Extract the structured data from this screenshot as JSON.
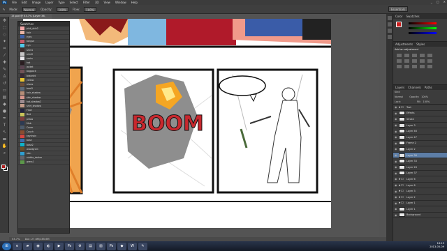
{
  "app": {
    "logo": "Ps"
  },
  "menu": [
    "File",
    "Edit",
    "Image",
    "Layer",
    "Type",
    "Select",
    "Filter",
    "3D",
    "View",
    "Window",
    "Help"
  ],
  "options": {
    "mode_label": "Mode:",
    "mode_value": "Normal",
    "opacity_label": "Opacity:",
    "opacity_value": "100%",
    "flow_label": "Flow:",
    "flow_value": "100%",
    "workspace": "Essentials"
  },
  "document": {
    "tab_title": "15.psd @ 53.7% (Layer 36, RGB/8#) *"
  },
  "swatches_panel": {
    "title": "Swatches",
    "items": [
      {
        "name": "pink_skin2",
        "color": "#f4a6a8"
      },
      {
        "name": "hair",
        "color": "#e8b3a4"
      },
      {
        "name": "eyes",
        "color": "#3c5fa7"
      },
      {
        "name": "tongue",
        "color": "#c45a6a"
      },
      {
        "name": "cyn",
        "color": "#50c8e8"
      },
      {
        "name": "shirt1",
        "color": "#3d2c2c"
      },
      {
        "name": "shirt2",
        "color": "#c7c5c6"
      },
      {
        "name": "socks",
        "color": "#e9e6ea"
      },
      {
        "name": "hat",
        "color": "#2a1d20"
      },
      {
        "name": "jacket",
        "color": "#5b4450"
      },
      {
        "name": "bagpack",
        "color": "#725357"
      },
      {
        "name": "bracelet",
        "color": "#3a2933"
      },
      {
        "name": "yellow",
        "color": "#e8c430"
      },
      {
        "name": "shoes",
        "color": "#6d4e38"
      },
      {
        "name": "boot2",
        "color": "#5d6a78"
      },
      {
        "name": "hair_shadow",
        "color": "#b58d77"
      },
      {
        "name": "skin_shadow",
        "color": "#d7968c"
      },
      {
        "name": "hat_shadow2",
        "color": "#9c8a8e"
      },
      {
        "name": "shirt_shadow",
        "color": "#c39a87"
      },
      {
        "name": "Floor",
        "color": "#23233e"
      },
      {
        "name": "Bed",
        "color": "#c9c35a"
      },
      {
        "name": "pillow",
        "color": "#7f3d3d"
      },
      {
        "name": "Mob",
        "color": "#2d3a53"
      },
      {
        "name": "Cover",
        "color": "#4e5b6a"
      },
      {
        "name": "Couch",
        "color": "#8a4d31"
      },
      {
        "name": "keychain",
        "color": "#d64540"
      },
      {
        "name": "base",
        "color": "#3c6db0"
      },
      {
        "name": "base2",
        "color": "#0fb3c9"
      },
      {
        "name": "woodgrain",
        "color": "#6b5028"
      },
      {
        "name": "skin",
        "color": "#2f9fd2"
      },
      {
        "name": "rubble_darker",
        "color": "#63646c"
      },
      {
        "name": "grass1",
        "color": "#5c984a"
      }
    ]
  },
  "layers_panel": {
    "tabs": [
      "Layers",
      "Channels",
      "Paths"
    ],
    "kind_label": "Kind",
    "blend_mode": "Normal",
    "opacity_label": "Opacity:",
    "opacity_value": "100%",
    "lock_label": "Lock:",
    "fill_label": "Fill:",
    "fill_value": "100%",
    "layers": [
      {
        "name": "Text",
        "type": "folder",
        "selected": false
      },
      {
        "name": "Effects",
        "type": "layer",
        "selected": false
      },
      {
        "name": "Stroke",
        "type": "layer",
        "selected": false
      },
      {
        "name": "Layer 3",
        "type": "layer",
        "selected": false
      },
      {
        "name": "Layer 46",
        "type": "layer",
        "selected": false
      },
      {
        "name": "Layer 47",
        "type": "layer",
        "selected": false
      },
      {
        "name": "Frame 2",
        "type": "layer",
        "selected": false
      },
      {
        "name": "Layer 2",
        "type": "layer",
        "selected": false
      },
      {
        "name": "Layer 36",
        "type": "layer",
        "selected": true
      },
      {
        "name": "Layer 33",
        "type": "layer",
        "selected": false
      },
      {
        "name": "Layer 26",
        "type": "layer",
        "selected": false
      },
      {
        "name": "Layer 37",
        "type": "layer",
        "selected": false
      },
      {
        "name": "Layer 6",
        "type": "folder",
        "selected": false
      },
      {
        "name": "Layer 8",
        "type": "folder",
        "selected": false
      },
      {
        "name": "Layer 3",
        "type": "folder",
        "selected": false
      },
      {
        "name": "Layer 2",
        "type": "folder",
        "selected": false
      },
      {
        "name": "Layer 1",
        "type": "folder",
        "selected": false
      },
      {
        "name": "Layer 1",
        "type": "layer",
        "selected": false
      },
      {
        "name": "Background",
        "type": "layer",
        "selected": false
      }
    ]
  },
  "adjustments_panel": {
    "tabs": [
      "Adjustments",
      "Styles"
    ],
    "heading": "Add an adjustment"
  },
  "color_panel": {
    "tabs": [
      "Color",
      "Swatches"
    ],
    "fg_color": "#cc2020"
  },
  "comic": {
    "sound_effect": "BOOM"
  },
  "status": {
    "zoom": "53.7%",
    "doc": "Doc: 27.6M/185.6M"
  },
  "taskbar": {
    "apps": [
      "start",
      "ie",
      "explorer",
      "chrome",
      "firefox",
      "media",
      "photoshop",
      "steam",
      "folder",
      "files",
      "ps2",
      "app",
      "word",
      "paint"
    ],
    "time": "16:15",
    "date": "2013-05-09"
  }
}
